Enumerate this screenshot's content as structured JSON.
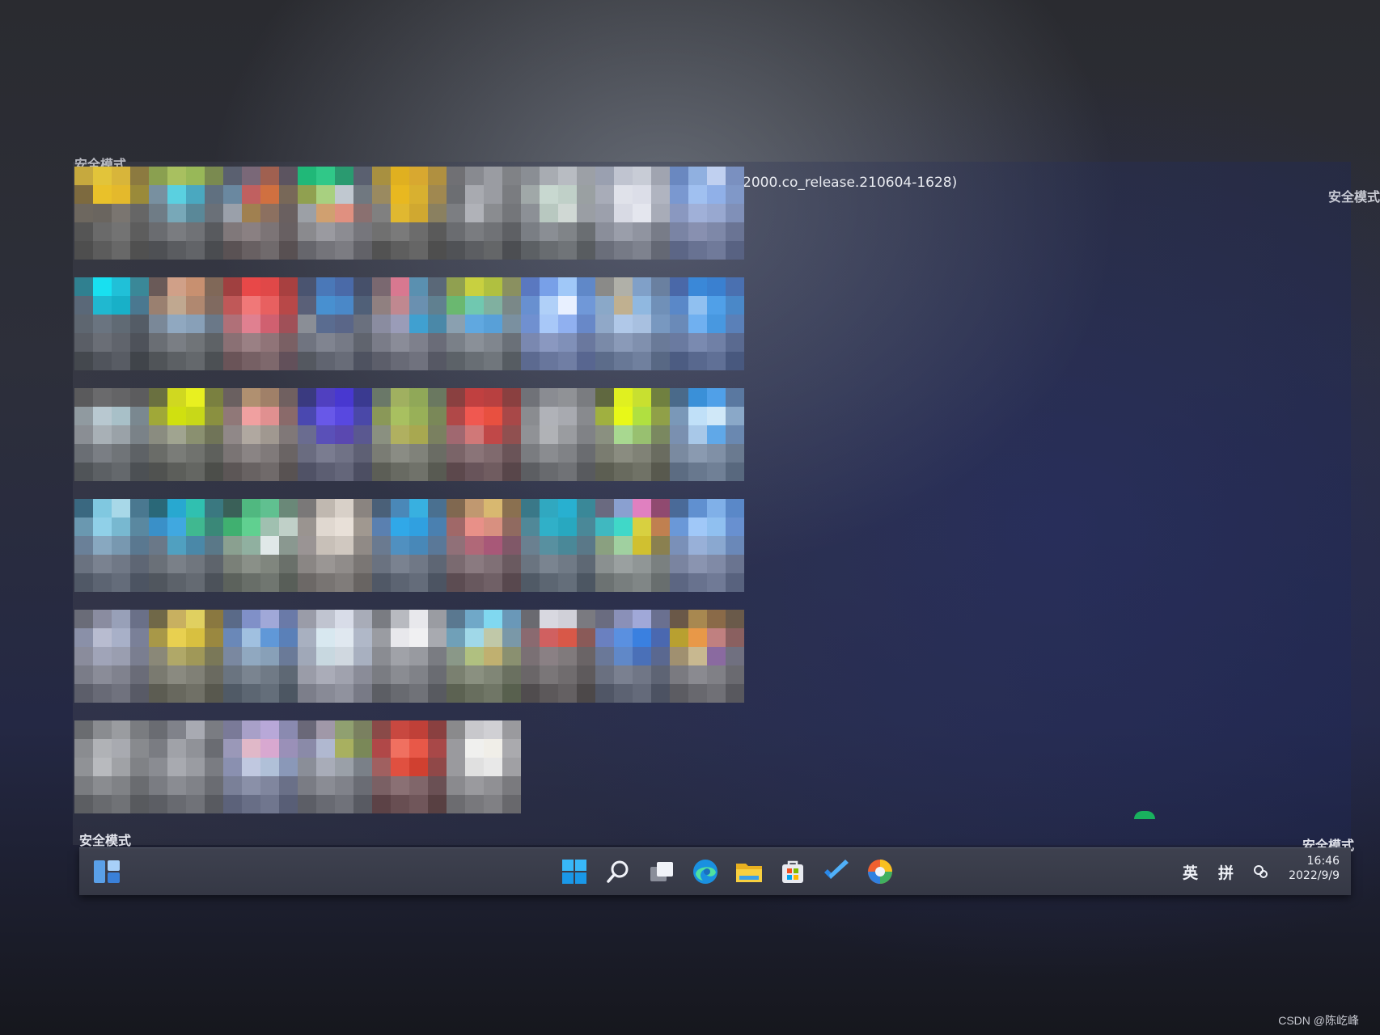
{
  "watermarks": {
    "top_left": "安全模式",
    "top_right": "安全模式",
    "bottom_left": "安全模式",
    "bottom_right": "安全模式"
  },
  "build_info": "2000.co_release.210604-1628)",
  "desktop_icons": [
    [
      "#c6a93e",
      "#e2c43a",
      "#d8b53a",
      "#8c7a40",
      "#7d6a3f",
      "#e9c12a",
      "#e4b92c",
      "#9a8a3a",
      "#6d675f",
      "#6a655f",
      "#7a7570",
      "#666",
      "#555",
      "#6a6a6a",
      "#737373",
      "#5d5d5d",
      "#4e4e4e",
      "#5c5c5c",
      "#686868",
      "#505050"
    ],
    [
      "#8aa050",
      "#a8c060",
      "#98b858",
      "#7a8a50",
      "#7890a0",
      "#5ad0e0",
      "#4aa8c0",
      "#607080",
      "#6f7c86",
      "#78a8b8",
      "#5a8898",
      "#6a7078",
      "#6a6c70",
      "#7a7c80",
      "#707276",
      "#585a5e",
      "#4e5054",
      "#5a5c60",
      "#626468",
      "#4a4c50"
    ],
    [
      "#5a6070",
      "#7a6878",
      "#a06050",
      "#5c5460",
      "#6a88a0",
      "#c06060",
      "#d07040",
      "#786858",
      "#9aa0aa",
      "#a08050",
      "#8c7060",
      "#6a6060",
      "#80787a",
      "#8a8082",
      "#7c7476",
      "#686062",
      "#5a5254",
      "#686062",
      "#706a6c",
      "#585052"
    ],
    [
      "#20b878",
      "#30c888",
      "#2a9a70",
      "#5a6070",
      "#90a050",
      "#a8d080",
      "#c0c8d0",
      "#707880",
      "#9ca0a6",
      "#d0a070",
      "#e09080",
      "#8a7070",
      "#8a8a8e",
      "#9a9aa0",
      "#8c8c92",
      "#76767c",
      "#66666c",
      "#74747a",
      "#7c7c82",
      "#626268"
    ],
    [
      "#a89040",
      "#e0b020",
      "#d8a830",
      "#b09040",
      "#9a8a60",
      "#e8b820",
      "#d8b030",
      "#a08850",
      "#808080",
      "#e0b830",
      "#d0a830",
      "#8a8060",
      "#707070",
      "#7a7a7a",
      "#6c6c6c",
      "#5a5a5a",
      "#525252",
      "#5e5e5e",
      "#666",
      "#4e4e4e"
    ],
    [
      "#707074",
      "#888a90",
      "#9a9ca2",
      "#808286",
      "#6c6e72",
      "#a8aab0",
      "#9a9ca2",
      "#7a7c80",
      "#7c7e82",
      "#b0b2b8",
      "#8a8c90",
      "#74767a",
      "#6a6c70",
      "#7a7c80",
      "#707276",
      "#5e6064",
      "#505256",
      "#5c5e62",
      "#646668",
      "#4c4e52"
    ],
    [
      "#8a8e94",
      "#a8acb2",
      "#b8bcc2",
      "#9ca0a6",
      "#a0a8a8",
      "#c8d8d0",
      "#c0d0c8",
      "#9aa0a2",
      "#8c9096",
      "#b8c8c0",
      "#d0d8d4",
      "#9a9ea4",
      "#7a7e84",
      "#8a8e94",
      "#808488",
      "#6a6e72",
      "#5c6064",
      "#686c70",
      "#707478",
      "#585c60"
    ],
    [
      "#9aa0b0",
      "#c0c4d0",
      "#c8ccd6",
      "#a0a4b0",
      "#a8acb8",
      "#e0e2ea",
      "#dcdee8",
      "#b0b4c0",
      "#9ca0ac",
      "#d8dae4",
      "#e4e6ee",
      "#a8acb8",
      "#8a8e9a",
      "#9a9eaa",
      "#9094a0",
      "#787c88",
      "#6a6e7a",
      "#767a86",
      "#7e828e",
      "#646874"
    ],
    [
      "#6a88c0",
      "#90b0e0",
      "#c0d0f0",
      "#7a90c0",
      "#7a98d0",
      "#a0c0f0",
      "#90b0e8",
      "#8098c8",
      "#8a98c0",
      "#a0b0d8",
      "#98a8d0",
      "#8090b8",
      "#7a84a4",
      "#8890b0",
      "#7e88a8",
      "#6a7494",
      "#5c6686",
      "#687292",
      "#707a9a",
      "#586282"
    ],
    [
      "#308090",
      "#18e0f0",
      "#20c0d8",
      "#3a8898",
      "#5a6878",
      "#20b8d0",
      "#18b0c8",
      "#4a7890",
      "#5e6670",
      "#6a7480",
      "#606a74",
      "#545c66",
      "#5a5e66",
      "#6a6e76",
      "#60646c",
      "#4e525a",
      "#44484e",
      "#50545c",
      "#585c64",
      "#40444a"
    ],
    [
      "#6a5a58",
      "#d0a088",
      "#c89070",
      "#806858",
      "#9a8070",
      "#c0a890",
      "#b08870",
      "#806a60",
      "#7a8898",
      "#90a8c0",
      "#88a0b8",
      "#6a7888",
      "#6a6e74",
      "#7a7e84",
      "#707478",
      "#5e6266",
      "#505458",
      "#5c6064",
      "#64686c",
      "#4c5054"
    ],
    [
      "#a04040",
      "#e84848",
      "#e04848",
      "#a84040",
      "#c05858",
      "#f07878",
      "#e86060",
      "#b84848",
      "#b07078",
      "#e08090",
      "#d06070",
      "#a05058",
      "#8a7074",
      "#9a8084",
      "#907478",
      "#7a6064",
      "#6a5458",
      "#766064",
      "#7e686c",
      "#62505a"
    ],
    [
      "#4a5470",
      "#4a78b8",
      "#4a6aa8",
      "#46506a",
      "#5a6078",
      "#4890d0",
      "#4a88c8",
      "#506078",
      "#8a8e96",
      "#5a6c90",
      "#5a6688",
      "#6a707e",
      "#707480",
      "#808490",
      "#767a86",
      "#60646e",
      "#545860",
      "#606470",
      "#686c78",
      "#4e5260"
    ],
    [
      "#7a6870",
      "#d87890",
      "#5a90b0",
      "#5a6878",
      "#908080",
      "#c08890",
      "#6a90b0",
      "#608090",
      "#8a8ca0",
      "#9a9cb8",
      "#40a0d0",
      "#4a88a8",
      "#7a7c88",
      "#8a8c98",
      "#7e808c",
      "#6a6c78",
      "#5c5e6a",
      "#686a76",
      "#70727e",
      "#565864"
    ],
    [
      "#90a050",
      "#c8d040",
      "#b0c040",
      "#8a9060",
      "#6ab870",
      "#70c8b0",
      "#80b0a0",
      "#7a8888",
      "#8aa0b0",
      "#60a8e0",
      "#58a0d8",
      "#7a90a0",
      "#7a8088",
      "#8a9098",
      "#80868e",
      "#6a7078",
      "#5c6268",
      "#686e74",
      "#70767c",
      "#565c62"
    ],
    [
      "#5a78c0",
      "#78a0e8",
      "#a0c8f8",
      "#6088c8",
      "#6890d0",
      "#b0d0f8",
      "#e8f0ff",
      "#7098d8",
      "#7090d0",
      "#a8c8f8",
      "#90b0f0",
      "#6888c8",
      "#7a88b0",
      "#8a98c0",
      "#8090b8",
      "#6a789e",
      "#5c6a90",
      "#68769c",
      "#707ea4",
      "#586690"
    ],
    [
      "#8a8a88",
      "#b0b0a8",
      "#80a0c8",
      "#6a80a0",
      "#8aa8c8",
      "#c0b090",
      "#90b8e0",
      "#7090b8",
      "#90a8c8",
      "#b0c8e8",
      "#a8c0e0",
      "#7898c0",
      "#7a8aa8",
      "#8a9ab8",
      "#8090ae",
      "#6a7a98",
      "#5c6c8a",
      "#687896",
      "#70809e",
      "#586884"
    ],
    [
      "#4a68a8",
      "#3a88d8",
      "#3a80d0",
      "#4a70b0",
      "#5a88c8",
      "#90c0f0",
      "#50a0e8",
      "#4a88c8",
      "#6a8ab8",
      "#70b0f0",
      "#4898e0",
      "#5a80b8",
      "#6a7aa0",
      "#7a8ab0",
      "#7080a6",
      "#5a6a90",
      "#4c5c82",
      "#58688e",
      "#607096",
      "#48587e"
    ],
    [
      "#5a5a5c",
      "#6a6a6c",
      "#646466",
      "#5c5c5e",
      "#909aa0",
      "#b8c8d0",
      "#a8c0c8",
      "#7a8890",
      "#8a8e94",
      "#a8b0b6",
      "#9aa2a8",
      "#7a8288",
      "#6a6e74",
      "#7a7e84",
      "#707478",
      "#5e6266",
      "#505458",
      "#5c6064",
      "#64686c",
      "#4c5054"
    ],
    [
      "#6a7040",
      "#d0d820",
      "#e8f020",
      "#7a8040",
      "#a0a838",
      "#d0e010",
      "#c8d818",
      "#8a9040",
      "#8a8c80",
      "#a0a490",
      "#8a9070",
      "#707458",
      "#6a6c68",
      "#7a7c78",
      "#70726e",
      "#5e605c",
      "#505250",
      "#5c5e5a",
      "#646662",
      "#4c4e4a"
    ],
    [
      "#6a6060",
      "#b09070",
      "#a08068",
      "#706060",
      "#907878",
      "#f0a0a0",
      "#e09090",
      "#8a6a6a",
      "#908888",
      "#b0a8a0",
      "#a09890",
      "#807878",
      "#7a7474",
      "#8a8484",
      "#807a7a",
      "#6a6464",
      "#5c5656",
      "#686262",
      "#706a6a",
      "#585252"
    ],
    [
      "#3a3a80",
      "#5040c0",
      "#4838d0",
      "#3a3a90",
      "#4a48b0",
      "#6858e8",
      "#5848e0",
      "#4a48a8",
      "#6a6c90",
      "#5a50b8",
      "#5a48b0",
      "#5a5890",
      "#6a6c80",
      "#7a7c90",
      "#707286",
      "#5e6074",
      "#505266",
      "#5c5e72",
      "#64667a",
      "#4c4e62"
    ],
    [
      "#6a7868",
      "#a0b060",
      "#90a858",
      "#6a7860",
      "#8a9858",
      "#a8c060",
      "#98b058",
      "#7a8858",
      "#8a9080",
      "#b0b060",
      "#a8a850",
      "#7a8060",
      "#7a7c74",
      "#8a8c84",
      "#80827a",
      "#6a6c64",
      "#5c5e56",
      "#686a62",
      "#70726a",
      "#585a52"
    ],
    [
      "#8a4040",
      "#c04040",
      "#b84040",
      "#8a4040",
      "#b04848",
      "#f05850",
      "#e85040",
      "#a84848",
      "#a06870",
      "#d07878",
      "#c04848",
      "#905050",
      "#7a6468",
      "#8a7478",
      "#806a6e",
      "#6a5458",
      "#5c484c",
      "#68545a",
      "#705c60",
      "#58464a"
    ],
    [
      "#707278",
      "#8a8c92",
      "#909296",
      "#7a7c80",
      "#8a8c90",
      "#b0b2b8",
      "#a8aab0",
      "#888a8e",
      "#909296",
      "#b0b2b6",
      "#9a9ca0",
      "#808286",
      "#7a7c80",
      "#8a8c90",
      "#808286",
      "#6a6c70",
      "#5c5e62",
      "#686a6e",
      "#707276",
      "#585a5e"
    ],
    [
      "#606840",
      "#e0f020",
      "#c8e030",
      "#708040",
      "#a0b040",
      "#e8f818",
      "#b0e040",
      "#90a048",
      "#8a9080",
      "#a8d890",
      "#98c070",
      "#7a8860",
      "#7a7c70",
      "#8a8c80",
      "#808276",
      "#6a6c60",
      "#5c5e52",
      "#686a5e",
      "#707266",
      "#58594e"
    ],
    [
      "#4a6a8a",
      "#3a90d8",
      "#50a0e8",
      "#5a78a0",
      "#7a98b8",
      "#c0e0f8",
      "#d0e8f8",
      "#8aa8c8",
      "#7a90b0",
      "#a8c8e8",
      "#60a8e8",
      "#6a88b0",
      "#7a8aa0",
      "#8a9ab0",
      "#8090a6",
      "#6a7a90",
      "#5c6c82",
      "#68788e",
      "#708096",
      "#58687e"
    ],
    [
      "#3a6880",
      "#80c8e0",
      "#a8d8e8",
      "#4a7890",
      "#6a98b0",
      "#90d0e8",
      "#78b8d0",
      "#5a88a0",
      "#6a8098",
      "#88a8c0",
      "#7898b0",
      "#5a7890",
      "#6a7280",
      "#7a8290",
      "#707886",
      "#5e6674",
      "#505866",
      "#5c6472",
      "#646c7a",
      "#4c5462"
    ],
    [
      "#2a6878",
      "#28a8d0",
      "#30c0b0",
      "#3a7880",
      "#3a90c8",
      "#40a8e0",
      "#40b890",
      "#3a8878",
      "#6a7888",
      "#50a0c0",
      "#4a88a8",
      "#5a7888",
      "#6a7078",
      "#7a8088",
      "#70767e",
      "#5e646c",
      "#50565e",
      "#5c626a",
      "#646a72",
      "#4c525a"
    ],
    [
      "#3a6058",
      "#50b880",
      "#60c090",
      "#6a8878",
      "#40b070",
      "#60d090",
      "#a0c0b0",
      "#c0d0c8",
      "#8aa090",
      "#90b0a0",
      "#e0e8e8",
      "#8a9890",
      "#7a8078",
      "#8a9088",
      "#80867e",
      "#6a706a",
      "#5c625c",
      "#686e68",
      "#707670",
      "#585e58"
    ],
    [
      "#7a7878",
      "#c0b8b0",
      "#d8d0c8",
      "#8a8480",
      "#9a9490",
      "#e0d8d0",
      "#e8e0d8",
      "#a09890",
      "#9a9494",
      "#c8c0b8",
      "#d0c8c0",
      "#908a86",
      "#8a8684",
      "#9a9694",
      "#908c8a",
      "#7a7674",
      "#6c6866",
      "#787472",
      "#807c7a",
      "#686462"
    ],
    [
      "#4a6078",
      "#4a88b8",
      "#38b0e0",
      "#4a7090",
      "#5a80b0",
      "#30a8e8",
      "#30a0e0",
      "#4a80b0",
      "#6a7a90",
      "#5090c0",
      "#4888b8",
      "#5a7898",
      "#6a7280",
      "#7a8290",
      "#707886",
      "#5e6674",
      "#505866",
      "#5c6472",
      "#646c7a",
      "#4c5462"
    ],
    [
      "#806850",
      "#c09870",
      "#d8b870",
      "#8a7050",
      "#a06868",
      "#e89088",
      "#d89080",
      "#906a60",
      "#907078",
      "#b06878",
      "#a85878",
      "#805868",
      "#7a6a70",
      "#8a7a80",
      "#807076",
      "#6a5a60",
      "#5c4c52",
      "#68585e",
      "#706066",
      "#58484e"
    ],
    [
      "#3a7888",
      "#30a8c0",
      "#28b0d0",
      "#3a8898",
      "#508898",
      "#30b0c8",
      "#28a8c0",
      "#4a8898",
      "#6a8090",
      "#5890a0",
      "#4a8898",
      "#5a7888",
      "#6a7480",
      "#7a8490",
      "#707a86",
      "#5e6874",
      "#505a66",
      "#5c6672",
      "#646e7a",
      "#4c5662"
    ],
    [
      "#6a6a80",
      "#8aa0d0",
      "#e080c0",
      "#904a70",
      "#40b8c0",
      "#40d8c8",
      "#d8d040",
      "#c08050",
      "#8aa080",
      "#a0d0a0",
      "#d0c030",
      "#8a8050",
      "#8a9090",
      "#9aa0a0",
      "#909696",
      "#7a8080",
      "#6c7272",
      "#787e7e",
      "#808686",
      "#686e6e"
    ],
    [
      "#4a6a98",
      "#6090d0",
      "#80b0e8",
      "#5a88c8",
      "#6a98d8",
      "#a0c8f8",
      "#90c0f0",
      "#6890d0",
      "#7a90b8",
      "#98b0d8",
      "#8aa8d0",
      "#6a88b8",
      "#7a84a0",
      "#8a94b0",
      "#808aa6",
      "#6a7490",
      "#5c6682",
      "#68728e",
      "#707a96",
      "#58627e"
    ],
    [
      "#6a6c78",
      "#8a8ca0",
      "#98a0b8",
      "#6a7088",
      "#8a90a8",
      "#b8bcd0",
      "#a8b0c8",
      "#7a8098",
      "#8a8c9c",
      "#a0a4b8",
      "#9a9eb0",
      "#7a7e90",
      "#7a7c88",
      "#8a8c98",
      "#80828e",
      "#6a6c78",
      "#5c5e6a",
      "#686a76",
      "#70727e",
      "#585a66"
    ],
    [
      "#706848",
      "#c8b060",
      "#e0d060",
      "#8a7840",
      "#a89848",
      "#e8d050",
      "#d8c040",
      "#9a8840",
      "#8a8878",
      "#b0a868",
      "#a09858",
      "#7a7858",
      "#7a7a70",
      "#8a8a80",
      "#808076",
      "#6a6a60",
      "#5c5c52",
      "#68685e",
      "#707066",
      "#58584e"
    ],
    [
      "#5a6a88",
      "#8090c8",
      "#a0a8d8",
      "#6a7aa8",
      "#6a88b8",
      "#a0c0e0",
      "#6098d8",
      "#5a80b8",
      "#7a88a0",
      "#90a8c0",
      "#88a0b8",
      "#6a7a98",
      "#6a7480",
      "#7a8490",
      "#707a86",
      "#5e6874",
      "#505a66",
      "#5c6672",
      "#646e7a",
      "#4c5662"
    ],
    [
      "#9a9ca8",
      "#c0c4d0",
      "#d8dce8",
      "#a8acb8",
      "#a8b0c0",
      "#d8e8f0",
      "#e0e8f0",
      "#b0b8c8",
      "#a0a8b8",
      "#c8d8e0",
      "#d0d8e0",
      "#a8b0c0",
      "#9a9ca8",
      "#aaacb8",
      "#a0a2ae",
      "#8a8c98",
      "#7c7e8a",
      "#888a96",
      "#90929e",
      "#787a86"
    ],
    [
      "#7a7c82",
      "#b8bac0",
      "#e8e8ec",
      "#9a9ca2",
      "#9a9ca2",
      "#e8e8ec",
      "#f0f0f2",
      "#a8aab0",
      "#8a8c92",
      "#a0a2a8",
      "#989aa0",
      "#7a7c82",
      "#7a7c82",
      "#8a8c92",
      "#808288",
      "#6a6c72",
      "#5c5e64",
      "#686a70",
      "#707278",
      "#585a60"
    ],
    [
      "#5a7890",
      "#70a8c8",
      "#80d8f0",
      "#6a98b8",
      "#70a0b8",
      "#a0d8e8",
      "#c0c8a8",
      "#7a98a8",
      "#8a9888",
      "#b0c080",
      "#c0b070",
      "#8a9070",
      "#7a8070",
      "#8a9080",
      "#808676",
      "#6a7060",
      "#5c6252",
      "#686e5e",
      "#707666",
      "#58604e"
    ],
    [
      "#6a6a70",
      "#d8d8e0",
      "#d0d0d8",
      "#7a7a80",
      "#8a6a70",
      "#d06060",
      "#d85848",
      "#8a5a58",
      "#7a7074",
      "#8a8084",
      "#807a7c",
      "#6a6466",
      "#6a6668",
      "#7a7678",
      "#706c6e",
      "#5e5a5c",
      "#504c4e",
      "#5c585a",
      "#646062",
      "#4c4849"
    ],
    [
      "#6a6c80",
      "#8a90b8",
      "#a0a8d8",
      "#6a7090",
      "#6a80c0",
      "#5a90e0",
      "#3a80e0",
      "#4a68b0",
      "#6a7898",
      "#6088c8",
      "#4a70b8",
      "#5a6890",
      "#6a7080",
      "#7a8090",
      "#707686",
      "#5e6474",
      "#505666",
      "#5c6272",
      "#646a7a",
      "#4c5262"
    ],
    [
      "#6a5848",
      "#a88850",
      "#8a6a48",
      "#6a5a4a",
      "#b8a030",
      "#e89848",
      "#c08080",
      "#8a6060",
      "#a09070",
      "#c8b890",
      "#8a6aa0",
      "#707080",
      "#7a7a80",
      "#8a8a90",
      "#808086",
      "#6a6a70",
      "#5c5c62",
      "#68686e",
      "#707076",
      "#58585e"
    ],
    [
      "#6a6c70",
      "#8a8c90",
      "#9a9ca0",
      "#7a7c80",
      "#8a8c90",
      "#b0b2b6",
      "#a8aab0",
      "#888a8e",
      "#909296",
      "#b8babe",
      "#a0a2a6",
      "#808286",
      "#7a7c80",
      "#8a8c90",
      "#808286",
      "#6a6c70",
      "#5c5e62",
      "#686a6e",
      "#707276",
      "#585a5e"
    ],
    [
      "#6a6c72",
      "#80828a",
      "#a8aab2",
      "#7a7c82",
      "#7a7c82",
      "#a0a2a8",
      "#909298",
      "#6a6c72",
      "#8a8c92",
      "#a8aab0",
      "#9a9ca2",
      "#7a7c82",
      "#7a7c82",
      "#8a8c92",
      "#808288",
      "#6a6c72",
      "#5c5e64",
      "#686a70",
      "#707278",
      "#585a60"
    ],
    [
      "#7a7a98",
      "#a8a0c8",
      "#b8a8d8",
      "#8a8ab0",
      "#9a98b8",
      "#e0b8c8",
      "#d8a8d0",
      "#9a90b8",
      "#8a90b0",
      "#c0c8e0",
      "#b0c0d8",
      "#8a98b8",
      "#7a8098",
      "#8a90a8",
      "#80869e",
      "#6a7088",
      "#5c627a",
      "#686e86",
      "#70768e",
      "#585e76"
    ],
    [
      "#6a6878",
      "#a098a8",
      "#90a070",
      "#7a8060",
      "#8a8aa8",
      "#b0b8d0",
      "#a8b060",
      "#7a8858",
      "#8a8e98",
      "#a8acb8",
      "#9aa0a8",
      "#7a8088",
      "#7a7c84",
      "#8a8c94",
      "#80828a",
      "#6a6c74",
      "#5c5e66",
      "#686a72",
      "#70727a",
      "#585a62"
    ],
    [
      "#8a4a48",
      "#c84840",
      "#c04038",
      "#8a4040",
      "#b04848",
      "#f07060",
      "#e85848",
      "#a84848",
      "#a06060",
      "#e05040",
      "#d04030",
      "#904848",
      "#7a6064",
      "#8a7074",
      "#80666a",
      "#6a5054",
      "#5c4246",
      "#684e52",
      "#70565a",
      "#584042"
    ],
    [
      "#8a8a8c",
      "#c8c8cc",
      "#d0d0d4",
      "#9a9a9e",
      "#9a9a9e",
      "#f0f0ee",
      "#f0eee8",
      "#aaaaae",
      "#9a9a9e",
      "#e0e0e0",
      "#e8e8e8",
      "#a0a0a4",
      "#8a8a8e",
      "#9a9a9e",
      "#909094",
      "#7a7a7e",
      "#6c6c70",
      "#78787c",
      "#808084",
      "#68686c"
    ]
  ],
  "taskbar": {
    "left_icon": "task-view-widget-icon",
    "pinned": [
      {
        "icon": "windows-start-icon"
      },
      {
        "icon": "search-icon"
      },
      {
        "icon": "task-view-icon"
      },
      {
        "icon": "edge-browser-icon"
      },
      {
        "icon": "file-explorer-icon"
      },
      {
        "icon": "microsoft-store-icon"
      },
      {
        "icon": "todo-check-icon"
      },
      {
        "icon": "colorful-app-icon"
      }
    ],
    "tray": {
      "language": "英",
      "ime": "拼",
      "time": "16:46",
      "date": "2022/9/9"
    }
  },
  "footer_credit": "CSDN @陈屹峰"
}
